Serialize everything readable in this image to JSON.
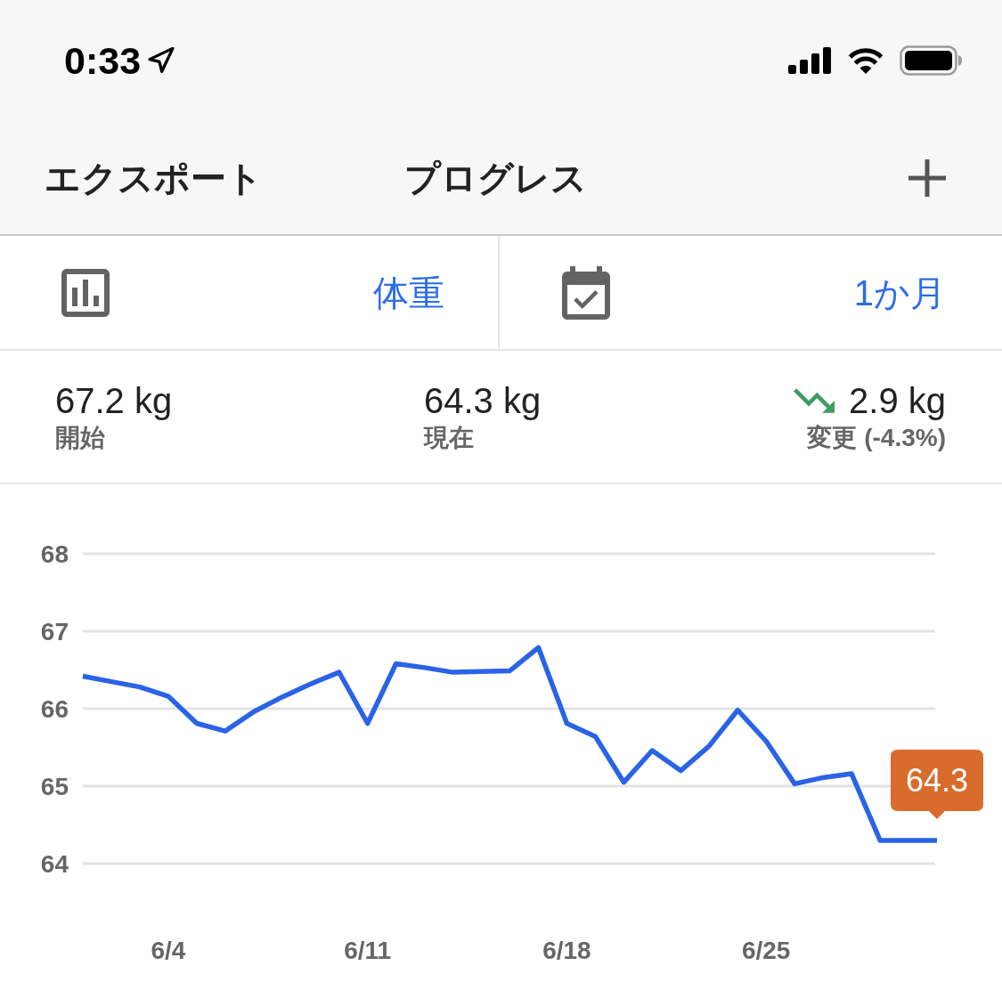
{
  "status_bar": {
    "time": "0:33"
  },
  "nav_bar": {
    "left_button": "エクスポート",
    "title": "プログレス"
  },
  "selectors": [
    {
      "kind": "metric",
      "value": "体重"
    },
    {
      "kind": "period",
      "value": "1か月"
    }
  ],
  "stats": [
    {
      "kind": "value",
      "value": "67.2 kg",
      "label": "開始"
    },
    {
      "kind": "value",
      "value": "64.3 kg",
      "label": "現在"
    },
    {
      "kind": "change",
      "value": "2.9 kg",
      "label": "変更 (-4.3%)",
      "decreased": true
    }
  ],
  "chart": {
    "chart_data": {
      "type": "line",
      "categories": [
        null,
        null,
        null,
        "6/4",
        null,
        null,
        null,
        null,
        null,
        null,
        "6/11",
        null,
        null,
        null,
        null,
        null,
        null,
        "6/18",
        null,
        null,
        null,
        null,
        null,
        null,
        "6/25",
        null,
        null,
        null,
        null,
        null,
        null
      ],
      "series": [
        {
          "color": "#2a63e6",
          "values": [
            66.42,
            66.35,
            66.28,
            66.16,
            65.81,
            65.71,
            65.96,
            66.15,
            66.32,
            66.47,
            65.81,
            66.58,
            66.53,
            66.47,
            66.48,
            66.49,
            66.79,
            65.81,
            65.64,
            65.05,
            65.46,
            65.2,
            65.52,
            65.98,
            65.58,
            65.03,
            65.11,
            65.16,
            64.3,
            64.3,
            64.3
          ]
        }
      ],
      "ylim": [
        64,
        68
      ],
      "yticks": [
        64,
        65,
        66,
        67,
        68
      ],
      "grid": true,
      "annotations": [
        {
          "y": 64.3,
          "text": "64.3"
        }
      ]
    }
  }
}
